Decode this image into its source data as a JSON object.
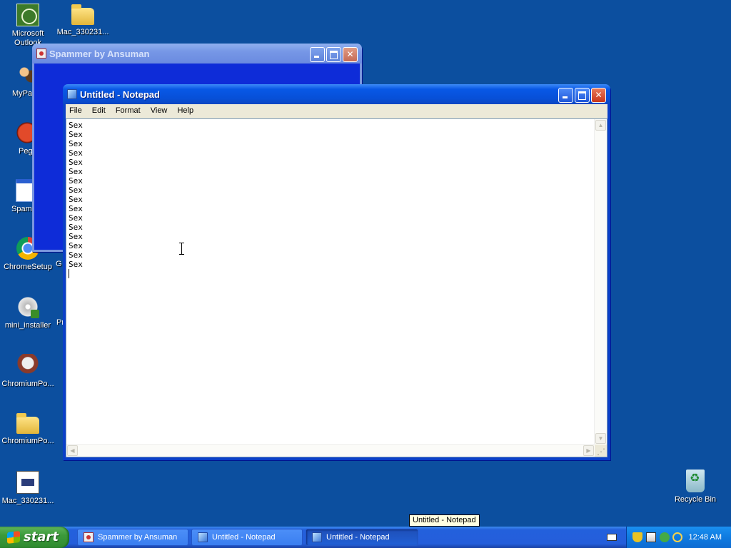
{
  "desktop": {
    "icons": [
      {
        "label": "Microsoft Outlook",
        "icon": "outlook-icon"
      },
      {
        "label": "Mac_330231...",
        "icon": "folder-icon"
      },
      {
        "label": "MyPa",
        "icon": "people-shortcut-icon"
      },
      {
        "label": "Peg",
        "icon": "red-ball-shortcut-icon"
      },
      {
        "label": "Spam",
        "icon": "application-icon"
      },
      {
        "label": "ChromeSetup",
        "icon": "chrome-setup-icon"
      },
      {
        "label": "G",
        "icon": ""
      },
      {
        "label": "mini_installer",
        "icon": "installer-disc-icon"
      },
      {
        "label": "Pr",
        "icon": ""
      },
      {
        "label": "ChromiumPo...",
        "icon": "chromium-app-icon"
      },
      {
        "label": "ChromiumPo...",
        "icon": "folder-icon"
      },
      {
        "label": "Mac_330231...",
        "icon": "document-icon"
      },
      {
        "label": "Recycle Bin",
        "icon": "recycle-bin-icon"
      }
    ]
  },
  "spammer_window": {
    "title": "Spammer by Ansuman"
  },
  "notepad": {
    "title": "Untitled - Notepad",
    "menu": [
      "File",
      "Edit",
      "Format",
      "View",
      "Help"
    ],
    "content": "Sex\nSex\nSex\nSex\nSex\nSex\nSex\nSex\nSex\nSex\nSex\nSex\nSex\nSex\nSex\nSex\n"
  },
  "taskbar": {
    "start_label": "start",
    "tasks": [
      {
        "label": "Spammer by Ansuman",
        "icon": "spammer-icon",
        "active": false
      },
      {
        "label": "Untitled - Notepad",
        "icon": "notepad-icon",
        "active": false
      },
      {
        "label": "Untitled - Notepad",
        "icon": "notepad-icon",
        "active": true
      }
    ],
    "clock": "12:48 AM"
  },
  "tooltip": "Untitled - Notepad",
  "colors": {
    "desktop": "#0c4f9f",
    "active_title": "#0858e6",
    "start_button": "#3c9a3b",
    "tray": "#0f7be0"
  }
}
